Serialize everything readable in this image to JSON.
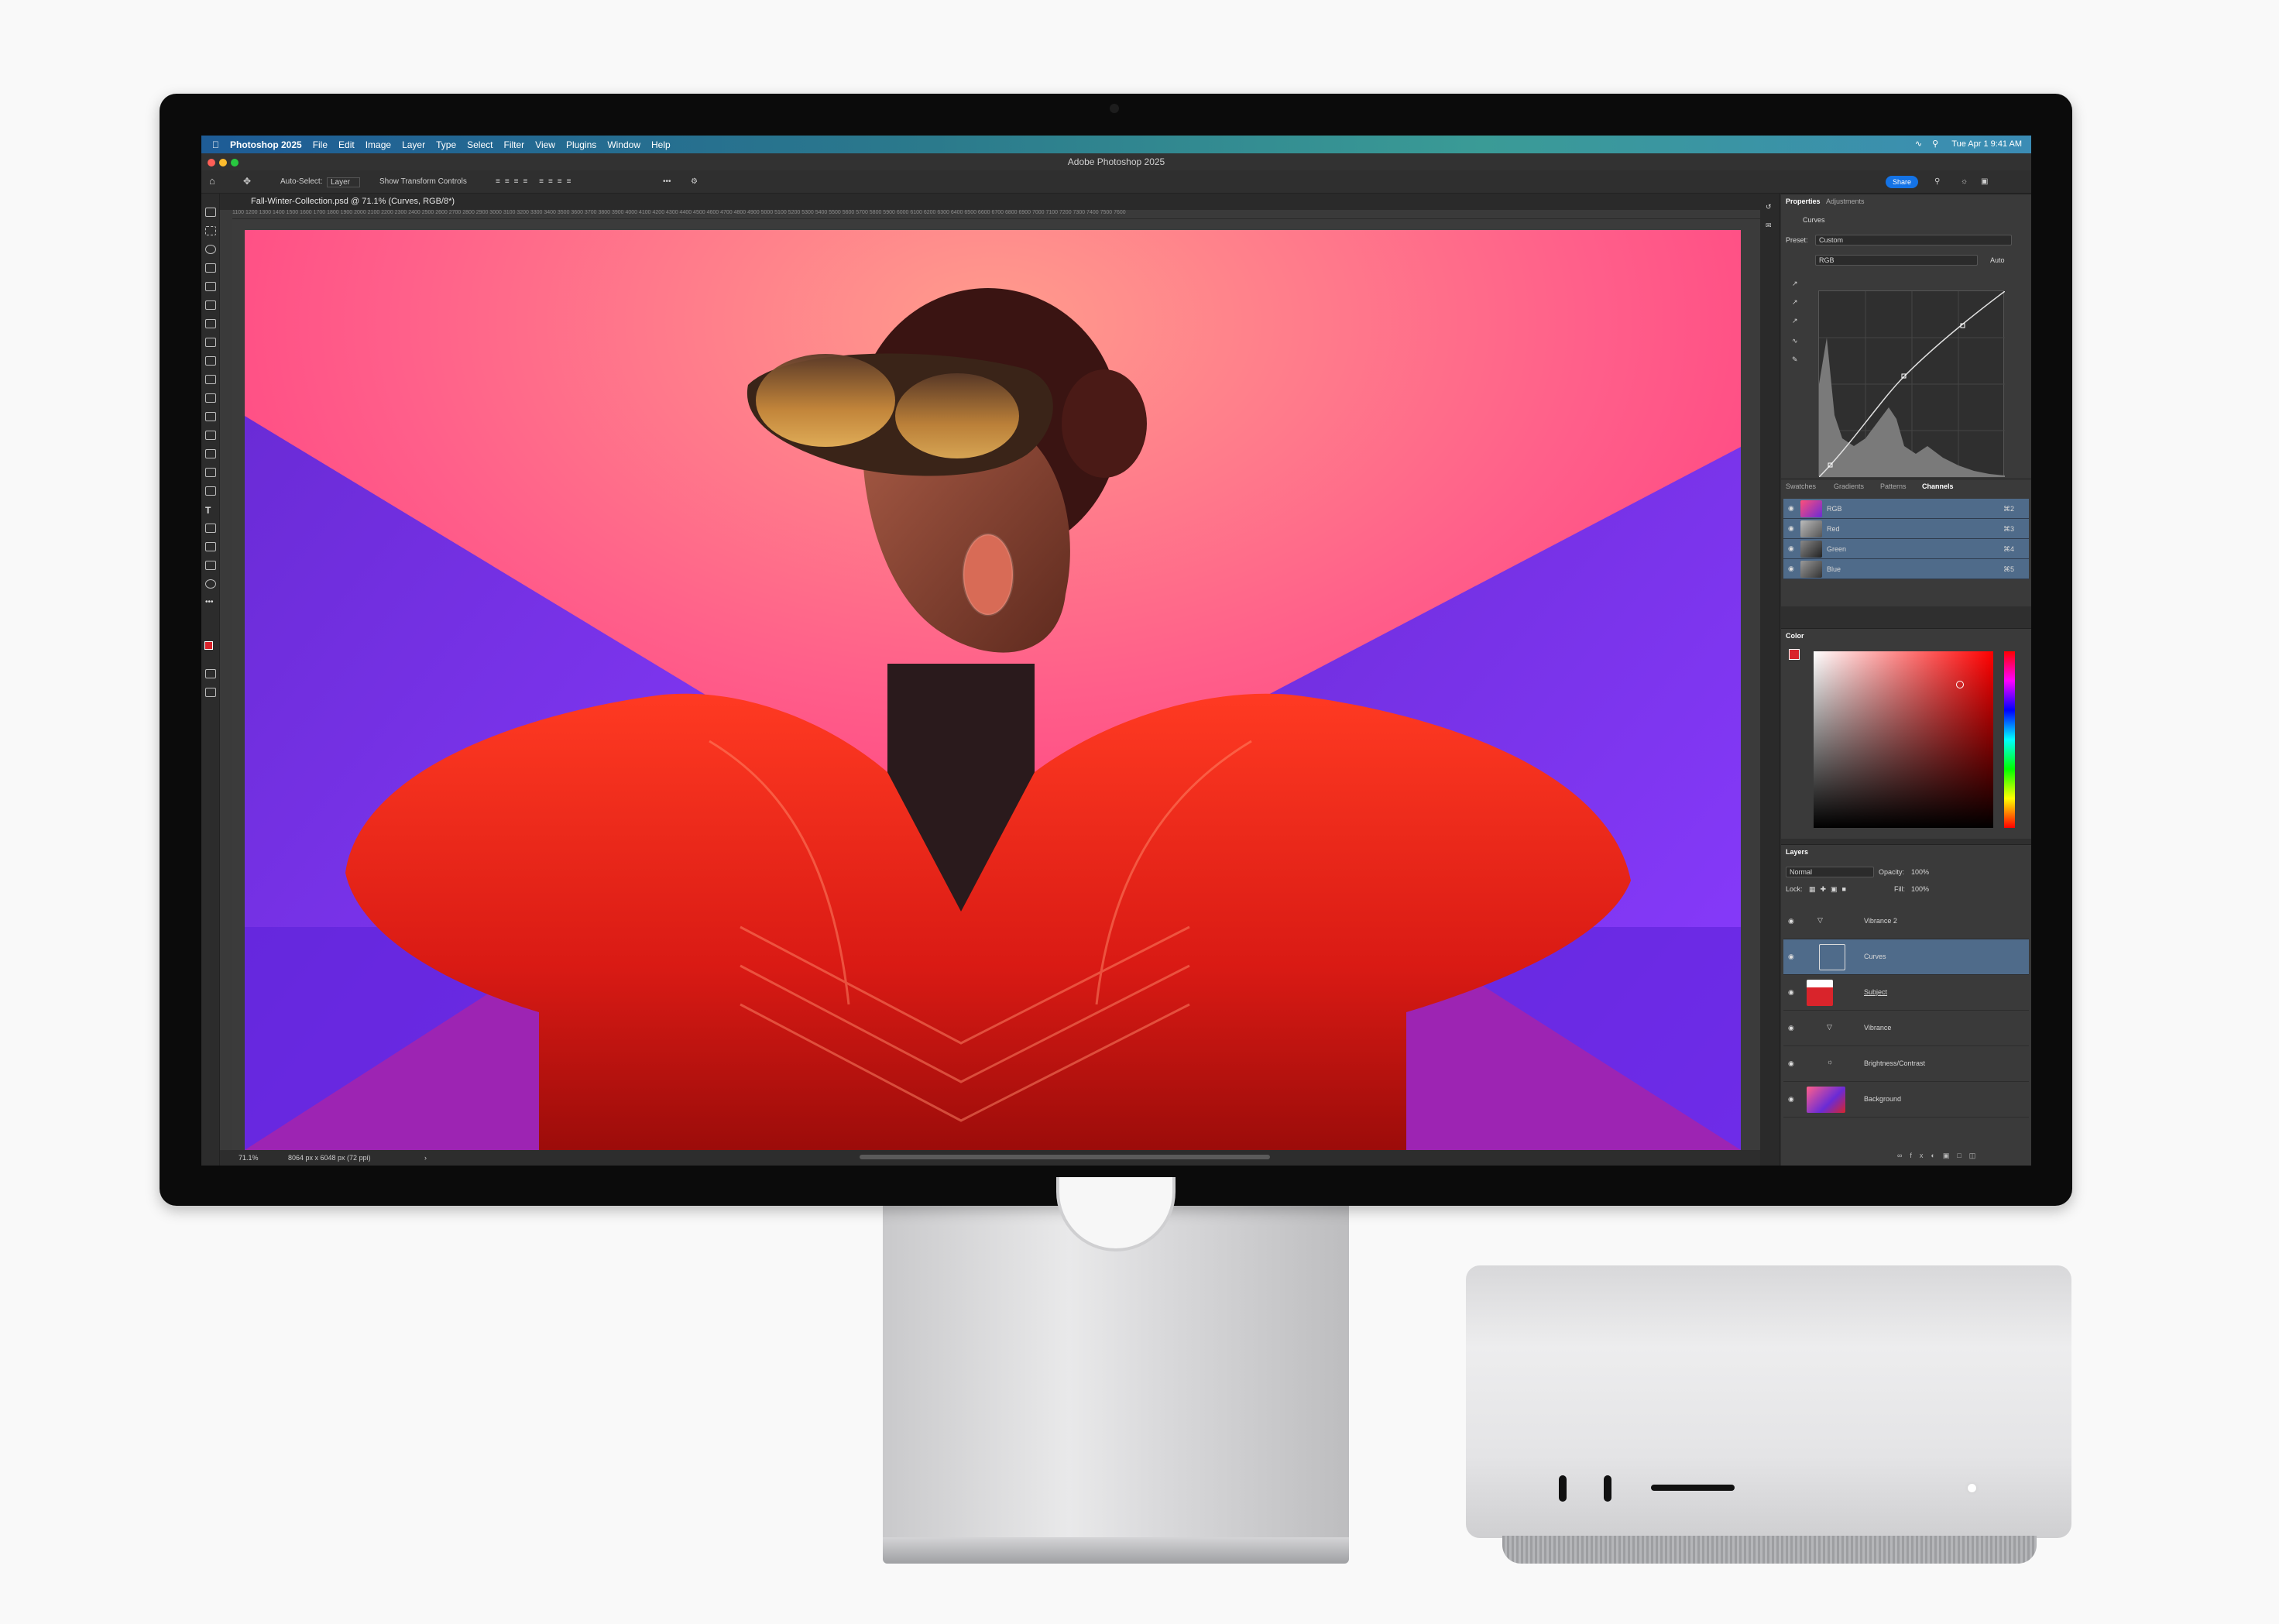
{
  "menubar": {
    "app_name": "Photoshop 2025",
    "items": [
      "File",
      "Edit",
      "Image",
      "Layer",
      "Type",
      "Select",
      "Filter",
      "View",
      "Plugins",
      "Window",
      "Help"
    ],
    "clock": "Tue Apr 1  9:41 AM"
  },
  "window": {
    "title": "Adobe Photoshop 2025"
  },
  "options": {
    "auto_select_label": "Auto-Select:",
    "auto_select_value": "Layer",
    "transform_label": "Show Transform Controls",
    "share_label": "Share"
  },
  "document": {
    "tab_title": "Fall-Winter-Collection.psd @ 71.1% (Curves, RGB/8*)",
    "ruler_ticks": "1100  1200  1300  1400  1500  1600  1700  1800  1900  2000  2100  2200  2300  2400  2500  2600  2700  2800  2900  3000  3100  3200  3300  3400  3500  3600  3700  3800  3900  4000  4100  4200  4300  4400  4500  4600  4700  4800  4900  5000  5100  5200  5300  5400  5500  5600  5700  5800  5900  6000  6100  6200  6300  6400  6500  6600  6700  6800  6900  7000  7100  7200  7300  7400  7500  7600"
  },
  "status": {
    "zoom": "71.1%",
    "doc_size": "8064 px x 6048 px (72 ppi)"
  },
  "properties": {
    "tabs": [
      "Properties",
      "Adjustments"
    ],
    "adjustment_name": "Curves",
    "preset_label": "Preset:",
    "preset_value": "Custom",
    "channel_value": "RGB",
    "auto_label": "Auto"
  },
  "channels_panel": {
    "tabs": [
      "Swatches",
      "Gradients",
      "Patterns",
      "Channels"
    ],
    "rows": [
      {
        "name": "RGB",
        "shortcut": "⌘2"
      },
      {
        "name": "Red",
        "shortcut": "⌘3"
      },
      {
        "name": "Green",
        "shortcut": "⌘4"
      },
      {
        "name": "Blue",
        "shortcut": "⌘5"
      }
    ]
  },
  "color_panel": {
    "title": "Color",
    "foreground": "#d9242b",
    "background": "#ffffff"
  },
  "layers_panel": {
    "title": "Layers",
    "blend_mode": "Normal",
    "opacity_label": "Opacity:",
    "opacity_value": "100%",
    "lock_label": "Lock:",
    "fill_label": "Fill:",
    "fill_value": "100%",
    "layers": [
      {
        "name": "Vibrance 2",
        "selected": false
      },
      {
        "name": "Curves",
        "selected": true
      },
      {
        "name": "Subject",
        "selected": false
      },
      {
        "name": "Vibrance",
        "selected": false
      },
      {
        "name": "Brightness/Contrast",
        "selected": false
      },
      {
        "name": "Background",
        "selected": false
      }
    ]
  },
  "icons": [
    "apple-icon",
    "home-icon",
    "move-tool-icon",
    "gear-icon",
    "search-icon",
    "bell-icon",
    "wifi-icon",
    "eye-icon"
  ]
}
